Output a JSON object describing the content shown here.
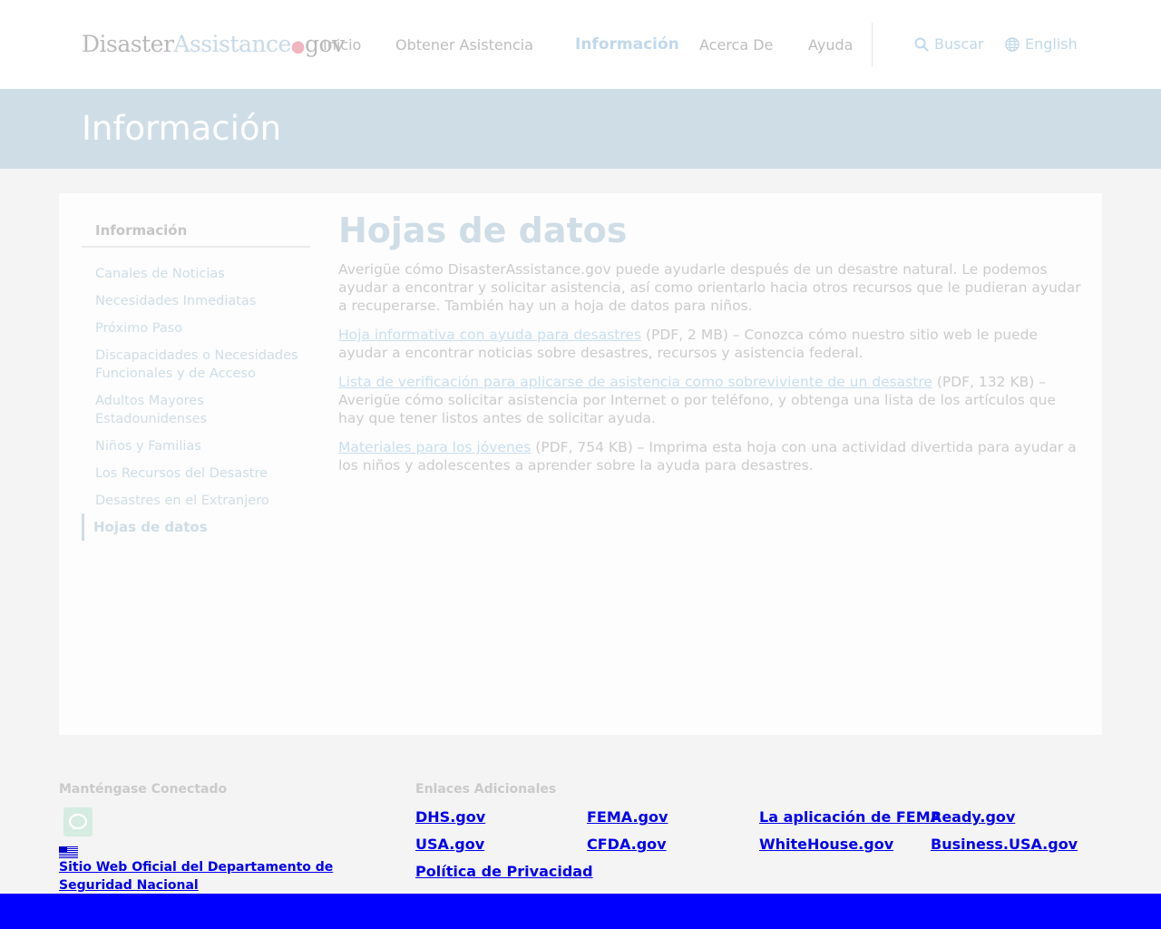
{
  "header": {
    "logo": {
      "part1": "Disaster",
      "part2": "Assistance",
      "dot": "●",
      "part3": "gov"
    },
    "nav": [
      {
        "label": "Inicio"
      },
      {
        "label": "Obtener Asistencia"
      },
      {
        "label": "Información",
        "active": true
      },
      {
        "label": "Acerca De"
      },
      {
        "label": "Ayuda"
      }
    ],
    "search_label": "Buscar",
    "language_label": "English"
  },
  "banner": {
    "title": "Información"
  },
  "sidebar": {
    "heading": "Información",
    "items": [
      {
        "label": "Canales de Noticias"
      },
      {
        "label": "Necesidades Inmediatas"
      },
      {
        "label": "Próximo Paso"
      },
      {
        "label": "Discapacidades o Necesidades Funcionales y de Acceso"
      },
      {
        "label": "Adultos Mayores Estadounidenses"
      },
      {
        "label": "Niños y Familias"
      },
      {
        "label": "Los Recursos del Desastre"
      },
      {
        "label": "Desastres en el Extranjero"
      }
    ],
    "current": "Hojas de datos"
  },
  "content": {
    "title": "Hojas de datos",
    "intro": "Averigüe cómo DisasterAssistance.gov puede ayudarle después de un desastre natural. Le podemos ayudar a encontrar y solicitar asistencia, así como orientarlo hacia otros recursos que le pudieran ayudar a recuperarse. También hay un a hoja de datos para niños.",
    "items": [
      {
        "link": "Hoja informativa con ayuda para desastres",
        "text": " (PDF, 2 MB) – Conozca cómo nuestro sitio web le puede ayudar a encontrar noticias sobre desastres, recursos y asistencia federal."
      },
      {
        "link": "Lista de verificación para aplicarse de asistencia como sobreviviente de un desastre",
        "text": " (PDF, 132 KB) – Averigüe cómo solicitar asistencia por Internet o por teléfono, y obtenga una lista de los artículos que hay que tener listos antes de solicitar ayuda."
      },
      {
        "link": "Materiales para los jóvenes",
        "text": " (PDF, 754 KB) – Imprima esta hoja con una actividad divertida para ayudar a los niños y adolescentes a aprender sobre la ayuda para desastres."
      }
    ]
  },
  "footer": {
    "connected_label": "Manténgase Conectado",
    "dhs_link": "Sitio Web Oficial del Departamento de Seguridad Nacional",
    "links_label": "Enlaces Adicionales",
    "links": [
      {
        "label": "DHS.gov"
      },
      {
        "label": "FEMA.gov"
      },
      {
        "label": "La aplicación de FEMA"
      },
      {
        "label": "Ready.gov"
      },
      {
        "label": "USA.gov"
      },
      {
        "label": "CFDA.gov"
      },
      {
        "label": "WhiteHouse.gov"
      },
      {
        "label": "Business.USA.gov"
      },
      {
        "label": "Política de Privacidad"
      }
    ]
  },
  "colors": {
    "accent_light_blue": "#cfdde6",
    "link_blue": "#0000ee",
    "bottom_bar": "#0000ff",
    "social_green": "#d5ece0"
  }
}
